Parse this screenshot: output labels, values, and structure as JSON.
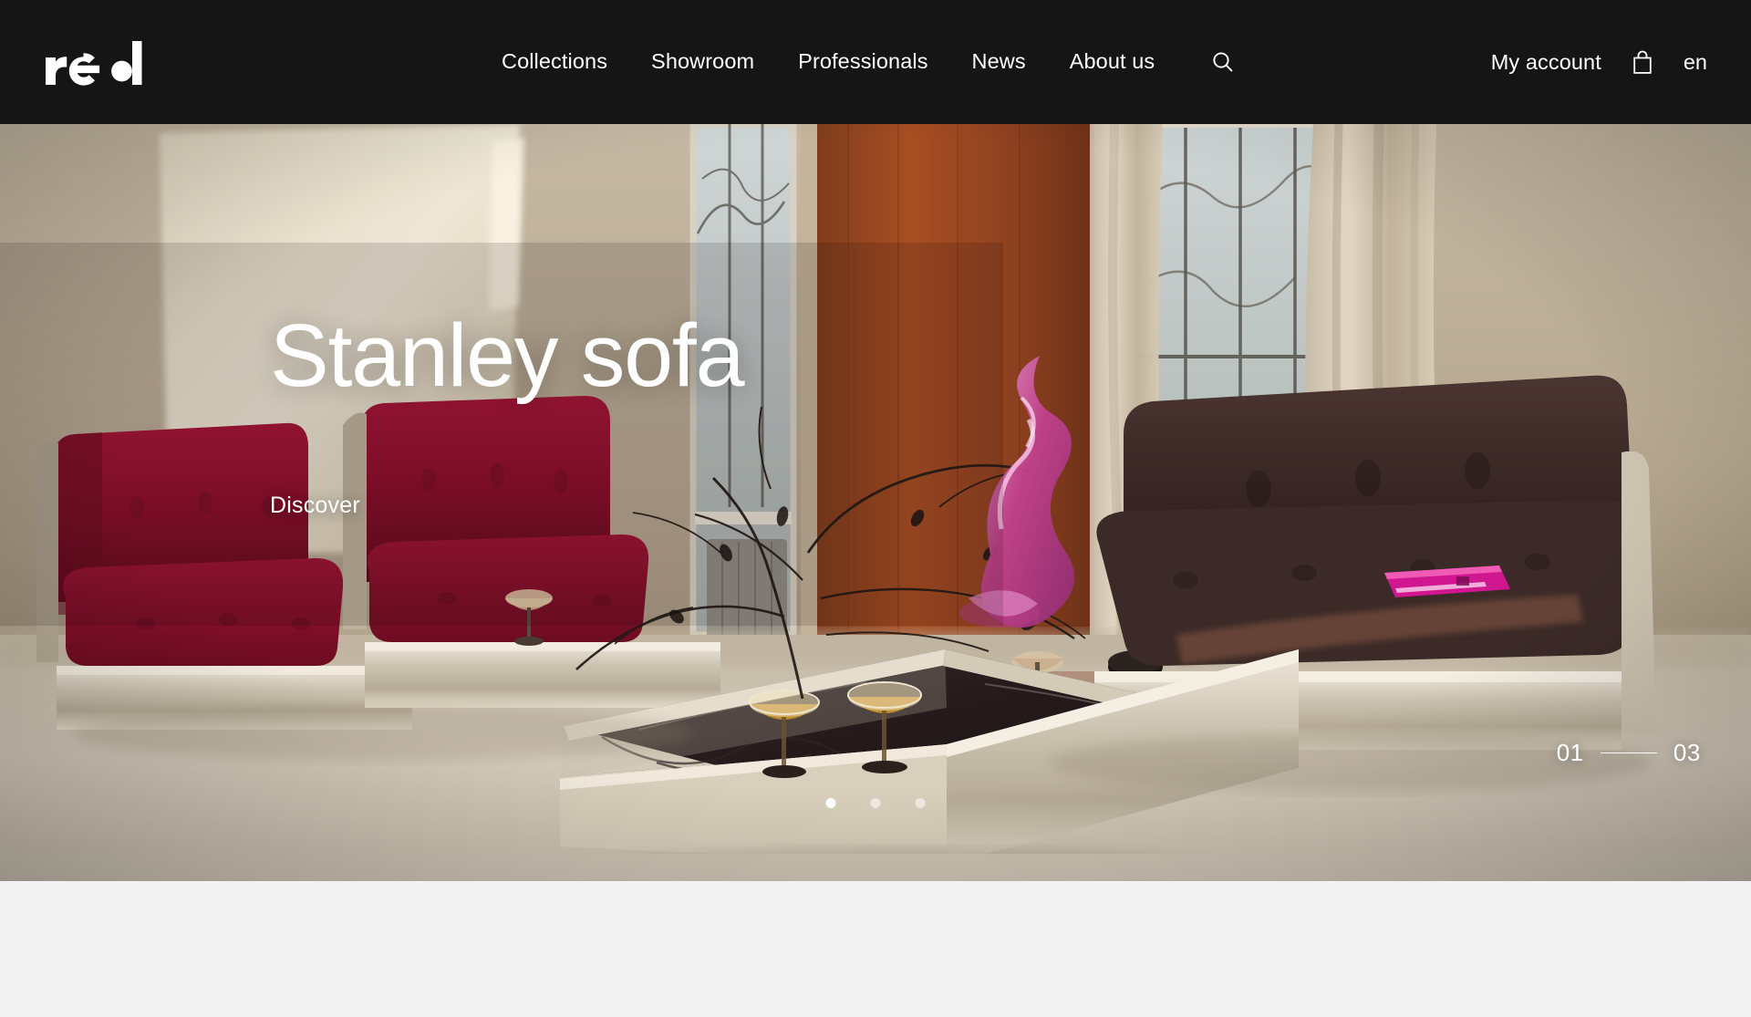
{
  "brand": {
    "name": "red",
    "logo_icon": "red-wordmark-logo"
  },
  "header": {
    "background": "#151515",
    "text_color": "#ffffff",
    "nav": [
      {
        "label": "Collections",
        "name": "collections"
      },
      {
        "label": "Showroom",
        "name": "showroom"
      },
      {
        "label": "Professionals",
        "name": "professionals"
      },
      {
        "label": "News",
        "name": "news"
      },
      {
        "label": "About us",
        "name": "about-us"
      }
    ],
    "search_icon": "search-icon",
    "account_label": "My account",
    "cart_icon": "shopping-bag-icon",
    "language": "en"
  },
  "hero": {
    "title": "Stanley sofa",
    "cta_label": "Discover",
    "counter_current": "01",
    "counter_total": "03",
    "dots": [
      {
        "active": true
      },
      {
        "active": false
      },
      {
        "active": false
      }
    ],
    "image_alt": "Interior living room with crimson velvet Stanley armchairs, brown velvet sofa and dark marble coffee table",
    "palette": {
      "wall_beige": "#b9ab95",
      "velvet_crimson": "#8e1230",
      "velvet_brown": "#3b2a28",
      "chrome": "#cfc7b8",
      "marble_dark": "#2a1f20",
      "carpet": "#cfc6b6",
      "wood_panel": "#9c4422",
      "glass_pink": "#d06aa8"
    }
  },
  "below_fold": {
    "background": "#f2f2f2"
  }
}
